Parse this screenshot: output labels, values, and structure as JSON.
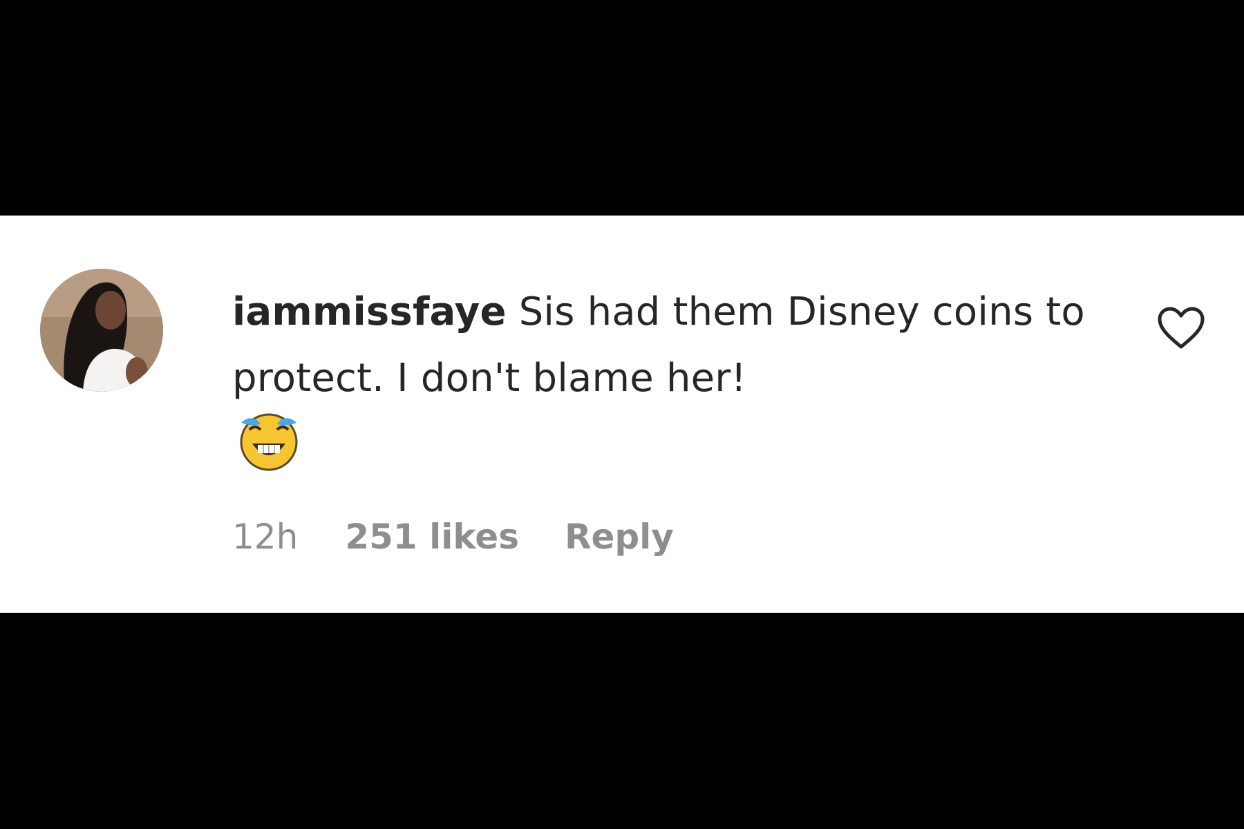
{
  "comment": {
    "username": "iammissfaye",
    "text": "Sis had them Disney coins to protect. I don't blame her!",
    "emoji": "crying-laughing-emoji",
    "time": "12h",
    "likes": "251 likes",
    "reply_label": "Reply"
  },
  "icons": {
    "like": "heart-outline-icon",
    "avatar": "profile-avatar"
  },
  "colors": {
    "background": "#000000",
    "card": "#ffffff",
    "text": "#262626",
    "meta": "#8e8e8e"
  }
}
